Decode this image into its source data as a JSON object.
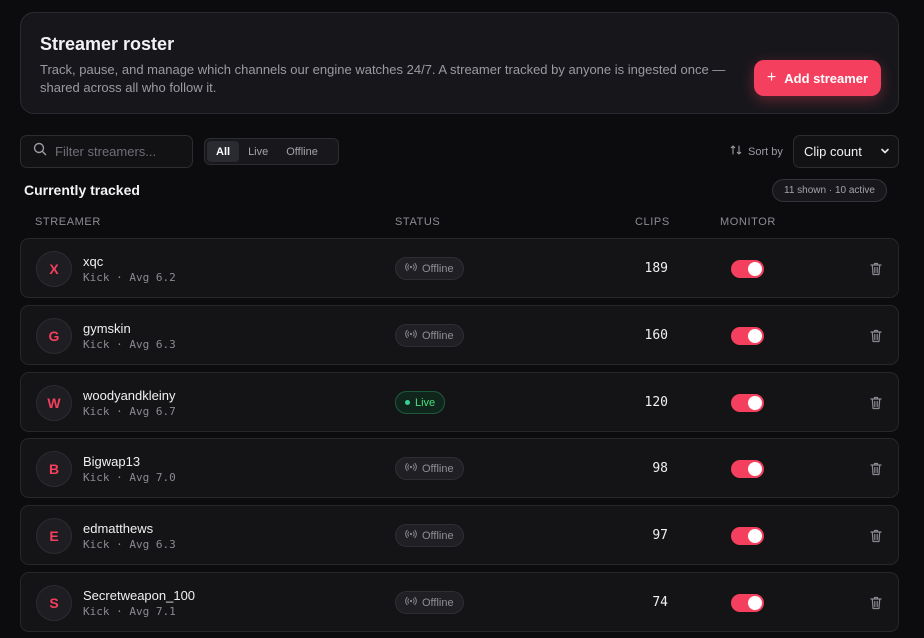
{
  "header": {
    "title": "Streamer roster",
    "description": "Track, pause, and manage which channels our engine watches 24/7. A streamer tracked by anyone is ingested once — shared across all who follow it.",
    "add_button_label": "Add streamer",
    "add_button_icon": "+"
  },
  "filter": {
    "placeholder": "Filter streamers...",
    "value": ""
  },
  "status_filter": {
    "options": [
      "All",
      "Live",
      "Offline"
    ],
    "selected": "All"
  },
  "sort": {
    "label": "Sort by",
    "selected": "Clip count"
  },
  "section": {
    "title": "Currently tracked",
    "count_badge": "11 shown · 10 active"
  },
  "columns": {
    "streamer": "STREAMER",
    "status": "STATUS",
    "clips": "CLIPS",
    "monitor": "MONITOR"
  },
  "colors": {
    "accent": "#f43f5e",
    "live": "#4ade80",
    "background": "#0c0c0e"
  },
  "rows": [
    {
      "initial": "X",
      "name": "xqc",
      "sub": "Kick · Avg 6.2",
      "status": "Offline",
      "live": false,
      "clips": "189",
      "monitor": true
    },
    {
      "initial": "G",
      "name": "gymskin",
      "sub": "Kick · Avg 6.3",
      "status": "Offline",
      "live": false,
      "clips": "160",
      "monitor": true
    },
    {
      "initial": "W",
      "name": "woodyandkleiny",
      "sub": "Kick · Avg 6.7",
      "status": "Live",
      "live": true,
      "clips": "120",
      "monitor": true
    },
    {
      "initial": "B",
      "name": "Bigwap13",
      "sub": "Kick · Avg 7.0",
      "status": "Offline",
      "live": false,
      "clips": "98",
      "monitor": true
    },
    {
      "initial": "E",
      "name": "edmatthews",
      "sub": "Kick · Avg 6.3",
      "status": "Offline",
      "live": false,
      "clips": "97",
      "monitor": true
    },
    {
      "initial": "S",
      "name": "Secretweapon_100",
      "sub": "Kick · Avg 7.1",
      "status": "Offline",
      "live": false,
      "clips": "74",
      "monitor": true
    }
  ]
}
